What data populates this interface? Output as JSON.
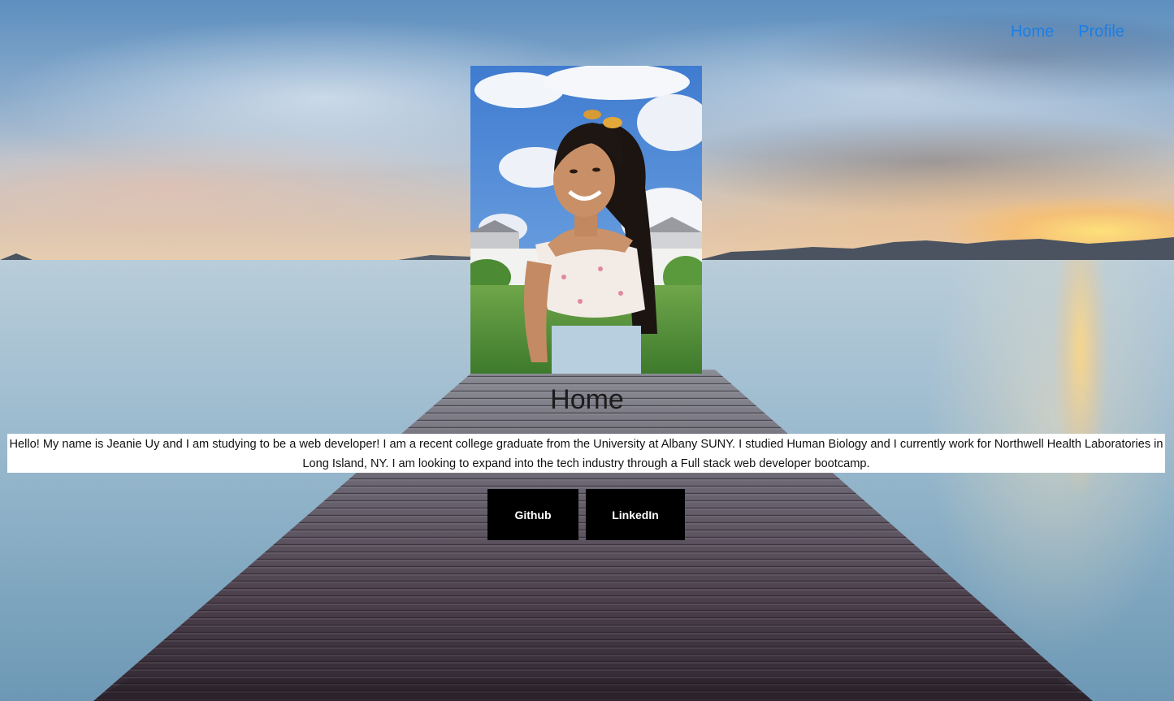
{
  "nav": {
    "items": [
      {
        "label": "Home"
      },
      {
        "label": "Profile"
      }
    ],
    "link_color": "#1a7ee8"
  },
  "main": {
    "title": "Home",
    "intro": "Hello! My name is Jeanie Uy and I am studying to be a web developer! I am a recent college graduate from the University at Albany SUNY. I studied Human Biology and I currently work for Northwell Health Laboratories in Long Island, NY. I am looking to expand into the tech industry through a Full stack web developer bootcamp.",
    "buttons": [
      {
        "label": "Github"
      },
      {
        "label": "LinkedIn"
      }
    ]
  }
}
